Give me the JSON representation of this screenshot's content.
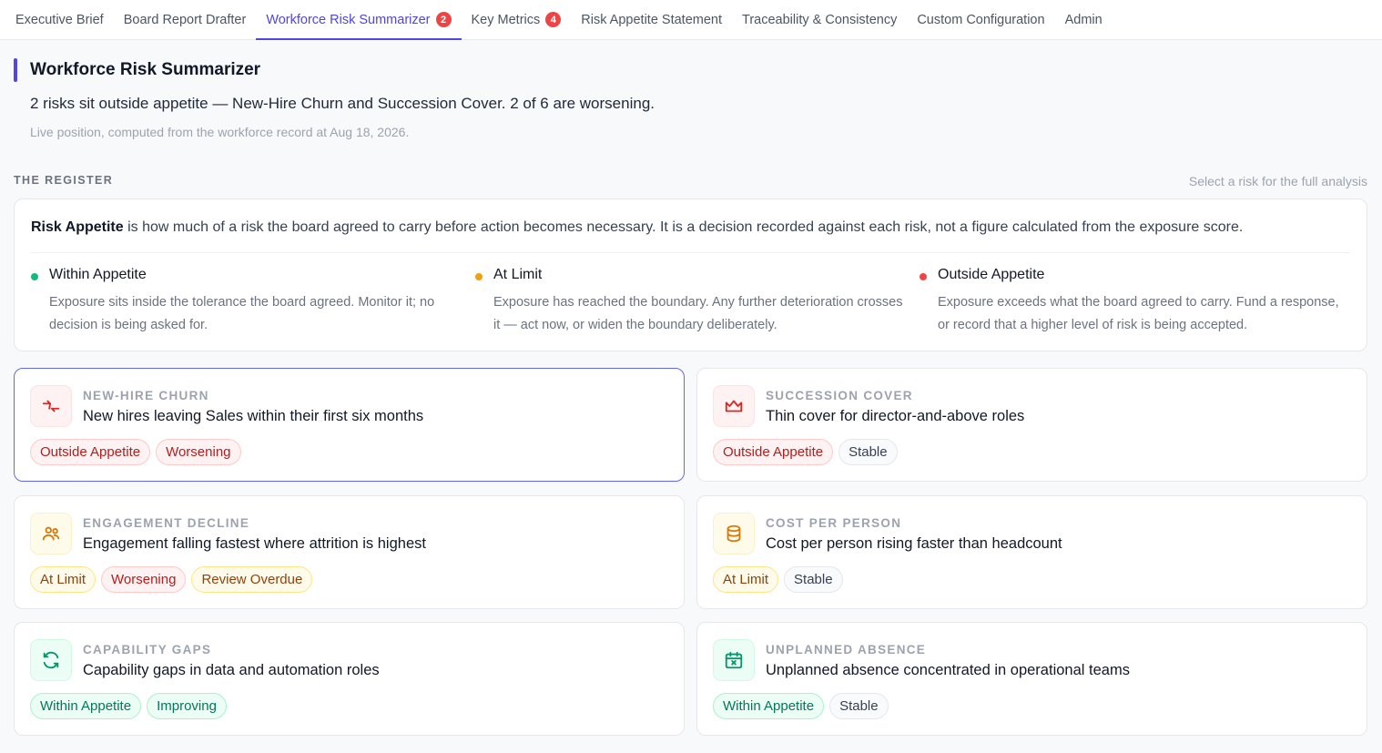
{
  "nav": {
    "tabs": [
      {
        "label": "Executive Brief"
      },
      {
        "label": "Board Report Drafter"
      },
      {
        "label": "Workforce Risk Summarizer",
        "badge": "2"
      },
      {
        "label": "Key Metrics",
        "badge": "4"
      },
      {
        "label": "Risk Appetite Statement"
      },
      {
        "label": "Traceability & Consistency"
      },
      {
        "label": "Custom Configuration"
      },
      {
        "label": "Admin"
      }
    ],
    "active": "Workforce Risk Summarizer"
  },
  "header": {
    "title": "Workforce Risk Summarizer",
    "summary": "2 risks sit outside appetite — New-Hire Churn and Succession Cover. 2 of 6 are worsening.",
    "subnote": "Live position, computed from the workforce record at Aug 18, 2026."
  },
  "register": {
    "label": "THE REGISTER",
    "hint": "Select a risk for the full analysis"
  },
  "explainer": {
    "term": "Risk Appetite",
    "text": " is how much of a risk the board agreed to carry before action becomes necessary. It is a decision recorded against each risk, not a figure calculated from the exposure score.",
    "legend": [
      {
        "title": "Within Appetite",
        "color": "#10b981",
        "desc": "Exposure sits inside the tolerance the board agreed. Monitor it; no decision is being asked for."
      },
      {
        "title": "At Limit",
        "color": "#f59e0b",
        "desc": "Exposure has reached the boundary. Any further deterioration crosses it — act now, or widen the boundary deliberately."
      },
      {
        "title": "Outside Appetite",
        "color": "#ef4444",
        "desc": "Exposure exceeds what the board agreed to carry. Fund a response, or record that a higher level of risk is being accepted."
      }
    ]
  },
  "risks": [
    {
      "kicker": "NEW-HIRE CHURN",
      "headline": "New hires leaving Sales within their first six months",
      "icon": "churn-arrows-icon",
      "tone": "red",
      "pills": [
        {
          "label": "Outside Appetite",
          "tone": "red"
        },
        {
          "label": "Worsening",
          "tone": "red"
        }
      ]
    },
    {
      "kicker": "SUCCESSION COVER",
      "headline": "Thin cover for director-and-above roles",
      "icon": "crown-icon",
      "tone": "red",
      "pills": [
        {
          "label": "Outside Appetite",
          "tone": "red"
        },
        {
          "label": "Stable",
          "tone": "gray"
        }
      ]
    },
    {
      "kicker": "ENGAGEMENT DECLINE",
      "headline": "Engagement falling fastest where attrition is highest",
      "icon": "users-icon",
      "tone": "amber",
      "pills": [
        {
          "label": "At Limit",
          "tone": "amber"
        },
        {
          "label": "Worsening",
          "tone": "red"
        },
        {
          "label": "Review Overdue",
          "tone": "amber"
        }
      ]
    },
    {
      "kicker": "COST PER PERSON",
      "headline": "Cost per person rising faster than headcount",
      "icon": "database-icon",
      "tone": "amber",
      "pills": [
        {
          "label": "At Limit",
          "tone": "amber"
        },
        {
          "label": "Stable",
          "tone": "gray"
        }
      ]
    },
    {
      "kicker": "CAPABILITY GAPS",
      "headline": "Capability gaps in data and automation roles",
      "icon": "refresh-icon",
      "tone": "green",
      "pills": [
        {
          "label": "Within Appetite",
          "tone": "green"
        },
        {
          "label": "Improving",
          "tone": "green"
        }
      ]
    },
    {
      "kicker": "UNPLANNED ABSENCE",
      "headline": "Unplanned absence concentrated in operational teams",
      "icon": "calendar-x-icon",
      "tone": "green",
      "pills": [
        {
          "label": "Within Appetite",
          "tone": "green"
        },
        {
          "label": "Stable",
          "tone": "gray"
        }
      ]
    }
  ]
}
